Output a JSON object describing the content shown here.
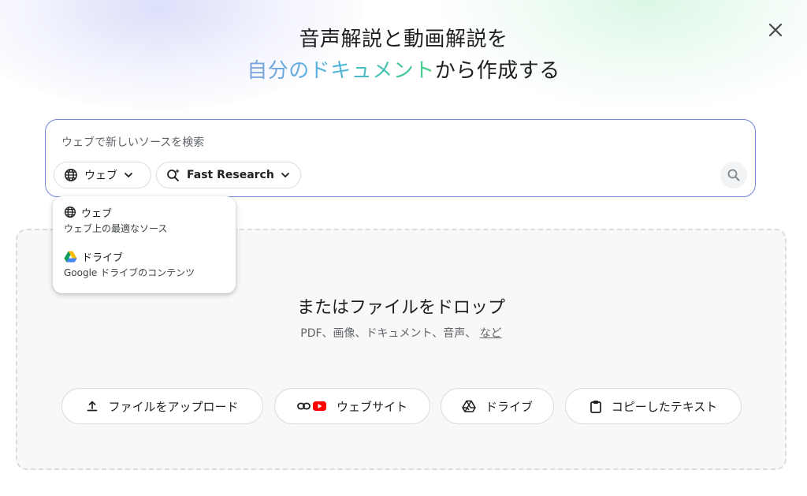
{
  "header": {
    "title_line1": "音声解説と動画解説を",
    "title_line2_highlight": "自分のドキュメント",
    "title_line2_rest": "から作成する"
  },
  "search": {
    "placeholder": "ウェブで新しいソースを検索",
    "source_chip_label": "ウェブ",
    "mode_chip_label": "Fast Research"
  },
  "source_menu": {
    "items": [
      {
        "label": "ウェブ",
        "description": "ウェブ上の最適なソース",
        "icon": "globe-icon"
      },
      {
        "label": "ドライブ",
        "description": "Google ドライブのコンテンツ",
        "icon": "google-drive-icon"
      }
    ]
  },
  "drop_zone": {
    "title": "またはファイルをドロップ",
    "subtitle": "PDF、画像、ドキュメント、音声、",
    "more_link": "など",
    "buttons": [
      {
        "label": "ファイルをアップロード",
        "icon": "upload-icon"
      },
      {
        "label": "ウェブサイト",
        "icon": "link-youtube-icon"
      },
      {
        "label": "ドライブ",
        "icon": "drive-outline-icon"
      },
      {
        "label": "コピーしたテキスト",
        "icon": "clipboard-icon"
      }
    ]
  },
  "colors": {
    "accent_border": "#6f86d6",
    "gradient_start": "#7da1dd",
    "gradient_end": "#3ecf82",
    "youtube_red": "#ff0000"
  }
}
